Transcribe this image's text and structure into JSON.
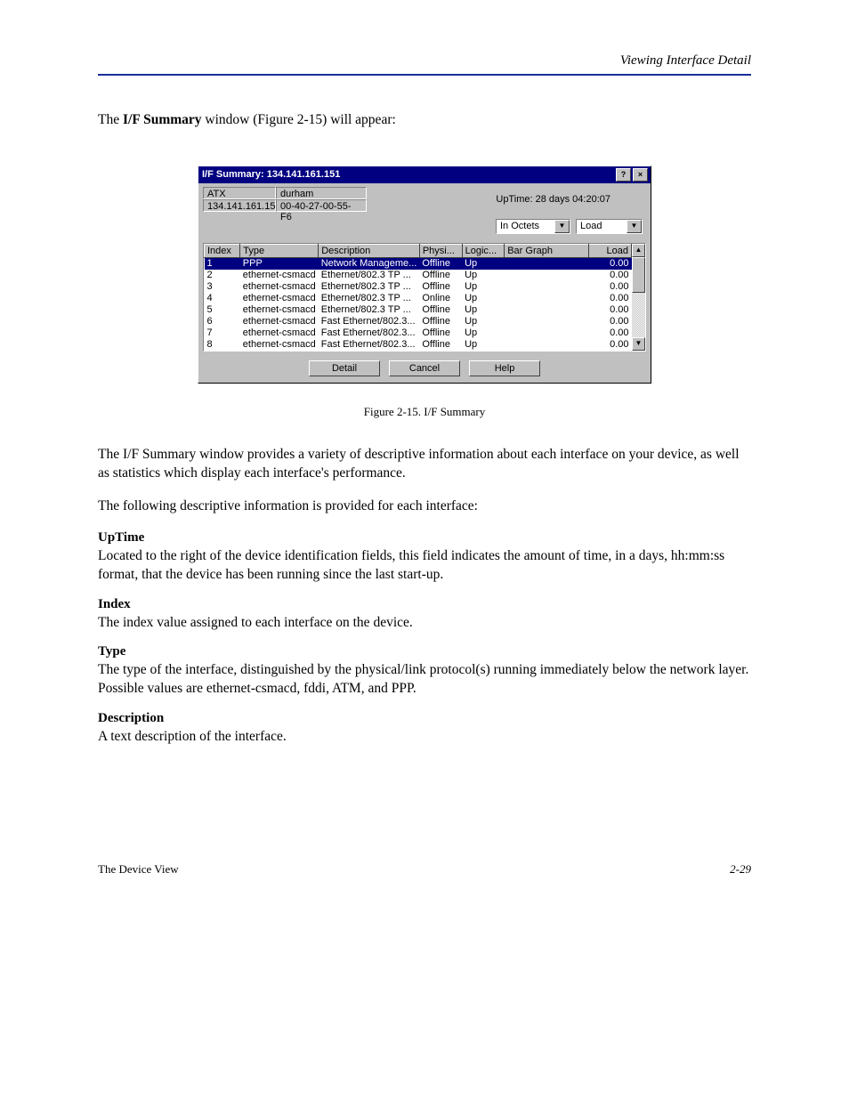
{
  "page": {
    "breadcrumb": "Viewing Interface Detail",
    "intro_prefix": "The ",
    "intro_bold": "I/F Summary",
    "intro_suffix": " window (Figure 2-15) will appear:",
    "footer_left": "The Device View",
    "footer_right": "2-29"
  },
  "dialog": {
    "title": "I/F Summary: 134.141.161.151",
    "name_label": "ATX",
    "ip_label": "134.141.161.151",
    "host_label": "durham",
    "mac_label": "00-40-27-00-55-F6",
    "uptime": "UpTime: 28 days 04:20:07",
    "dropdown1": "In Octets",
    "dropdown2": "Load",
    "headers": [
      "Index",
      "Type",
      "Description",
      "Physi...",
      "Logic...",
      "Bar Graph",
      "Load"
    ],
    "rows": [
      {
        "idx": "1",
        "type": "PPP",
        "desc": "Network Manageme...",
        "phy": "Offline",
        "log": "Up",
        "load": "0.00",
        "selected": true
      },
      {
        "idx": "2",
        "type": "ethernet-csmacd",
        "desc": "Ethernet/802.3 TP ...",
        "phy": "Offline",
        "log": "Up",
        "load": "0.00"
      },
      {
        "idx": "3",
        "type": "ethernet-csmacd",
        "desc": "Ethernet/802.3 TP ...",
        "phy": "Offline",
        "log": "Up",
        "load": "0.00"
      },
      {
        "idx": "4",
        "type": "ethernet-csmacd",
        "desc": "Ethernet/802.3 TP ...",
        "phy": "Online",
        "log": "Up",
        "load": "0.00"
      },
      {
        "idx": "5",
        "type": "ethernet-csmacd",
        "desc": "Ethernet/802.3 TP ...",
        "phy": "Offline",
        "log": "Up",
        "load": "0.00"
      },
      {
        "idx": "6",
        "type": "ethernet-csmacd",
        "desc": "Fast Ethernet/802.3...",
        "phy": "Offline",
        "log": "Up",
        "load": "0.00"
      },
      {
        "idx": "7",
        "type": "ethernet-csmacd",
        "desc": "Fast Ethernet/802.3...",
        "phy": "Offline",
        "log": "Up",
        "load": "0.00"
      },
      {
        "idx": "8",
        "type": "ethernet-csmacd",
        "desc": "Fast Ethernet/802.3...",
        "phy": "Offline",
        "log": "Up",
        "load": "0.00"
      }
    ],
    "buttons": {
      "detail": "Detail",
      "cancel": "Cancel",
      "help": "Help"
    }
  },
  "caption": "Figure 2-15. I/F Summary",
  "after_fig": "The I/F Summary window provides a variety of descriptive information about each interface on your device, as well as statistics which display each interface's performance.",
  "after_fig_2": "The following descriptive information is provided for each interface:",
  "defs": {
    "uptime_label": "UpTime",
    "uptime_body": "Located to the right of the device identification fields, this field indicates the amount of time, in a days, hh:mm:ss format, that the device has been running since the last start-up.",
    "index_label": "Index",
    "index_body": "The index value assigned to each interface on the device.",
    "type_label": "Type",
    "type_body": "The type of the interface, distinguished by the physical/link protocol(s) running immediately below the network layer. Possible values are ethernet-csmacd, fddi, ATM, and PPP.",
    "desc_label": "Description",
    "desc_body": "A text description of the interface."
  }
}
